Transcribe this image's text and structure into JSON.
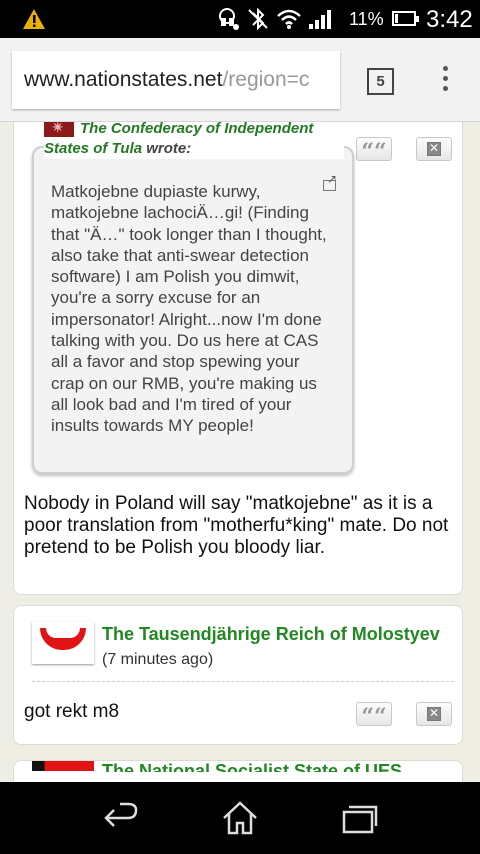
{
  "status_bar": {
    "battery_percent": "11%",
    "time": "3:42",
    "icons": [
      "warning-icon",
      "headset-icon",
      "bluetooth-icon",
      "wifi-icon",
      "signal-icon",
      "battery-icon"
    ]
  },
  "browser": {
    "url_host": "www.nationstates.net",
    "url_path": "/region=c",
    "tab_count": "5"
  },
  "posts": [
    {
      "quote": {
        "author": "The Confederacy of Independent States of Tula",
        "wrote_label": "wrote:",
        "text": "Matkojebne dupiaste kurwy, matkojebne lachociÄ…gi! (Finding that \"Ä…\" took longer than I thought, also take that anti-swear detection software) I am Polish you dimwit, you're a sorry excuse for an impersonator! Alright...now I'm done talking with you. Do us here at CAS all a favor and stop spewing your crap on our RMB, you're making us all look bad and I'm tired of your insults towards MY people!"
      },
      "text": "Nobody in Poland will say \"matkojebne\" as it is a poor translation from \"motherfu*king\" mate. Do not pretend to be Polish you bloody liar.",
      "quote_button": "““"
    },
    {
      "author": "The Tausendjährige Reich of Molostyev",
      "time": "(7 minutes ago)",
      "text": "got rekt m8",
      "quote_button": "““"
    },
    {
      "author": "The National Socialist State of UES"
    }
  ],
  "colors": {
    "nation_link": "#228822",
    "background": "#eeeee4"
  }
}
